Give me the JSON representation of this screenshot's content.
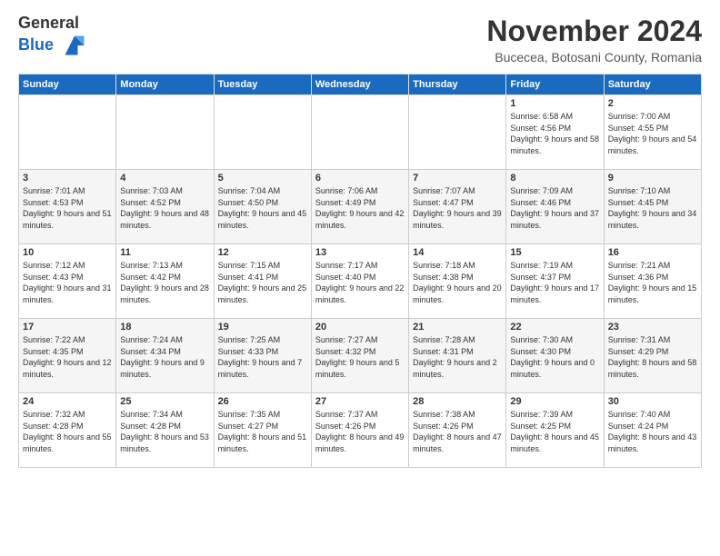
{
  "header": {
    "logo_line1": "General",
    "logo_line2": "Blue",
    "month_title": "November 2024",
    "location": "Bucecea, Botosani County, Romania"
  },
  "days_of_week": [
    "Sunday",
    "Monday",
    "Tuesday",
    "Wednesday",
    "Thursday",
    "Friday",
    "Saturday"
  ],
  "weeks": [
    [
      {
        "day": "",
        "info": ""
      },
      {
        "day": "",
        "info": ""
      },
      {
        "day": "",
        "info": ""
      },
      {
        "day": "",
        "info": ""
      },
      {
        "day": "",
        "info": ""
      },
      {
        "day": "1",
        "info": "Sunrise: 6:58 AM\nSunset: 4:56 PM\nDaylight: 9 hours and 58 minutes."
      },
      {
        "day": "2",
        "info": "Sunrise: 7:00 AM\nSunset: 4:55 PM\nDaylight: 9 hours and 54 minutes."
      }
    ],
    [
      {
        "day": "3",
        "info": "Sunrise: 7:01 AM\nSunset: 4:53 PM\nDaylight: 9 hours and 51 minutes."
      },
      {
        "day": "4",
        "info": "Sunrise: 7:03 AM\nSunset: 4:52 PM\nDaylight: 9 hours and 48 minutes."
      },
      {
        "day": "5",
        "info": "Sunrise: 7:04 AM\nSunset: 4:50 PM\nDaylight: 9 hours and 45 minutes."
      },
      {
        "day": "6",
        "info": "Sunrise: 7:06 AM\nSunset: 4:49 PM\nDaylight: 9 hours and 42 minutes."
      },
      {
        "day": "7",
        "info": "Sunrise: 7:07 AM\nSunset: 4:47 PM\nDaylight: 9 hours and 39 minutes."
      },
      {
        "day": "8",
        "info": "Sunrise: 7:09 AM\nSunset: 4:46 PM\nDaylight: 9 hours and 37 minutes."
      },
      {
        "day": "9",
        "info": "Sunrise: 7:10 AM\nSunset: 4:45 PM\nDaylight: 9 hours and 34 minutes."
      }
    ],
    [
      {
        "day": "10",
        "info": "Sunrise: 7:12 AM\nSunset: 4:43 PM\nDaylight: 9 hours and 31 minutes."
      },
      {
        "day": "11",
        "info": "Sunrise: 7:13 AM\nSunset: 4:42 PM\nDaylight: 9 hours and 28 minutes."
      },
      {
        "day": "12",
        "info": "Sunrise: 7:15 AM\nSunset: 4:41 PM\nDaylight: 9 hours and 25 minutes."
      },
      {
        "day": "13",
        "info": "Sunrise: 7:17 AM\nSunset: 4:40 PM\nDaylight: 9 hours and 22 minutes."
      },
      {
        "day": "14",
        "info": "Sunrise: 7:18 AM\nSunset: 4:38 PM\nDaylight: 9 hours and 20 minutes."
      },
      {
        "day": "15",
        "info": "Sunrise: 7:19 AM\nSunset: 4:37 PM\nDaylight: 9 hours and 17 minutes."
      },
      {
        "day": "16",
        "info": "Sunrise: 7:21 AM\nSunset: 4:36 PM\nDaylight: 9 hours and 15 minutes."
      }
    ],
    [
      {
        "day": "17",
        "info": "Sunrise: 7:22 AM\nSunset: 4:35 PM\nDaylight: 9 hours and 12 minutes."
      },
      {
        "day": "18",
        "info": "Sunrise: 7:24 AM\nSunset: 4:34 PM\nDaylight: 9 hours and 9 minutes."
      },
      {
        "day": "19",
        "info": "Sunrise: 7:25 AM\nSunset: 4:33 PM\nDaylight: 9 hours and 7 minutes."
      },
      {
        "day": "20",
        "info": "Sunrise: 7:27 AM\nSunset: 4:32 PM\nDaylight: 9 hours and 5 minutes."
      },
      {
        "day": "21",
        "info": "Sunrise: 7:28 AM\nSunset: 4:31 PM\nDaylight: 9 hours and 2 minutes."
      },
      {
        "day": "22",
        "info": "Sunrise: 7:30 AM\nSunset: 4:30 PM\nDaylight: 9 hours and 0 minutes."
      },
      {
        "day": "23",
        "info": "Sunrise: 7:31 AM\nSunset: 4:29 PM\nDaylight: 8 hours and 58 minutes."
      }
    ],
    [
      {
        "day": "24",
        "info": "Sunrise: 7:32 AM\nSunset: 4:28 PM\nDaylight: 8 hours and 55 minutes."
      },
      {
        "day": "25",
        "info": "Sunrise: 7:34 AM\nSunset: 4:28 PM\nDaylight: 8 hours and 53 minutes."
      },
      {
        "day": "26",
        "info": "Sunrise: 7:35 AM\nSunset: 4:27 PM\nDaylight: 8 hours and 51 minutes."
      },
      {
        "day": "27",
        "info": "Sunrise: 7:37 AM\nSunset: 4:26 PM\nDaylight: 8 hours and 49 minutes."
      },
      {
        "day": "28",
        "info": "Sunrise: 7:38 AM\nSunset: 4:26 PM\nDaylight: 8 hours and 47 minutes."
      },
      {
        "day": "29",
        "info": "Sunrise: 7:39 AM\nSunset: 4:25 PM\nDaylight: 8 hours and 45 minutes."
      },
      {
        "day": "30",
        "info": "Sunrise: 7:40 AM\nSunset: 4:24 PM\nDaylight: 8 hours and 43 minutes."
      }
    ]
  ]
}
